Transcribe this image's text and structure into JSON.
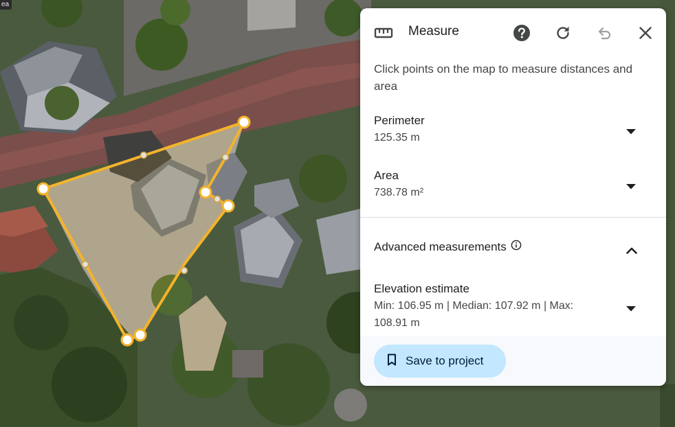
{
  "map": {
    "corner_label": "ea"
  },
  "panel": {
    "title": "Measure",
    "icons": {
      "ruler": "ruler-icon",
      "help": "help-icon",
      "reset": "refresh-icon",
      "undo": "undo-icon",
      "close": "close-icon"
    },
    "instructions": "Click points on the map to measure distances and area",
    "perimeter": {
      "label": "Perimeter",
      "value": "125.35 m"
    },
    "area": {
      "label": "Area",
      "value": "738.78 m²"
    },
    "advanced": {
      "label": "Advanced measurements"
    },
    "elevation": {
      "label": "Elevation estimate",
      "value": "Min: 106.95 m | Median: 107.92 m | Max: 108.91 m"
    },
    "save_label": "Save to project"
  },
  "colors": {
    "measure_line": "#f4b32c",
    "save_button_bg": "#c2e7ff",
    "panel_bg": "#ffffff"
  }
}
